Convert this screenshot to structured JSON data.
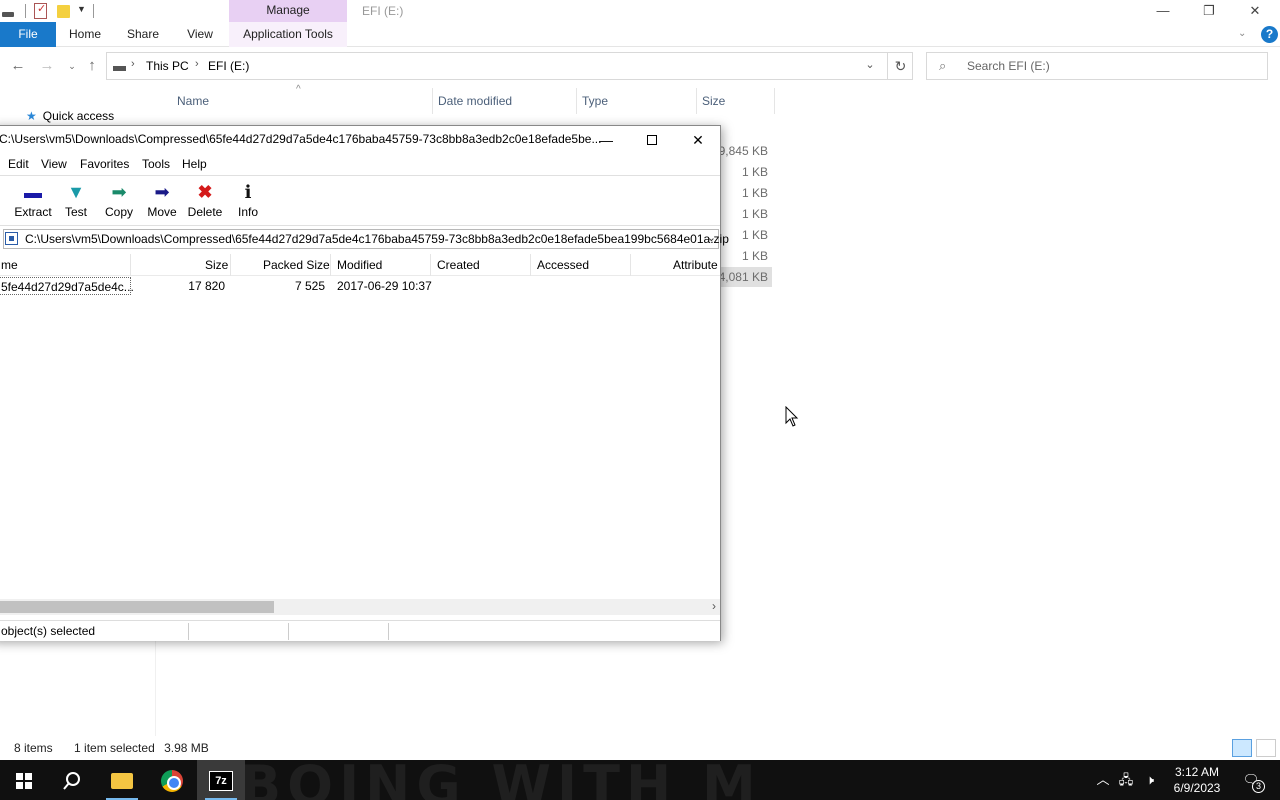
{
  "explorer": {
    "title": "EFI (E:)",
    "contextual_group": "Manage",
    "ribbon_tabs": {
      "file": "File",
      "home": "Home",
      "share": "Share",
      "view": "View",
      "app_tools": "Application Tools"
    },
    "breadcrumb": [
      "This PC",
      "EFI (E:)"
    ],
    "search_placeholder": "Search EFI (E:)",
    "columns": {
      "name": "Name",
      "date": "Date modified",
      "type": "Type",
      "size": "Size"
    },
    "nav_pane": {
      "quick_access": "Quick access"
    },
    "sizes": [
      "9,845 KB",
      "1 KB",
      "1 KB",
      "1 KB",
      "1 KB",
      "1 KB",
      "4,081 KB"
    ],
    "status": {
      "items": "8 items",
      "selected": "1 item selected",
      "selected_size": "3.98 MB"
    }
  },
  "zip": {
    "title": "C:\\Users\\vm5\\Downloads\\Compressed\\65fe44d27d29d7a5de4c176baba45759-73c8bb8a3edb2c0e18efade5be...",
    "menu": {
      "edit": "Edit",
      "view": "View",
      "favorites": "Favorites",
      "tools": "Tools",
      "help": "Help"
    },
    "toolbar": {
      "extract": "Extract",
      "test": "Test",
      "copy": "Copy",
      "move": "Move",
      "delete": "Delete",
      "info": "Info"
    },
    "path": "C:\\Users\\vm5\\Downloads\\Compressed\\65fe44d27d29d7a5de4c176baba45759-73c8bb8a3edb2c0e18efade5bea199bc5684e01a.zip",
    "columns": {
      "name": "me",
      "size": "Size",
      "packed": "Packed Size",
      "modified": "Modified",
      "created": "Created",
      "accessed": "Accessed",
      "attributes": "Attribute"
    },
    "rows": [
      {
        "name": "5fe44d27d29d7a5de4c...",
        "size": "17 820",
        "packed": "7 525",
        "modified": "2017-06-29 10:37",
        "created": "",
        "accessed": "",
        "attributes": ""
      }
    ],
    "status": "object(s) selected"
  },
  "taskbar": {
    "time": "3:12 AM",
    "date": "6/9/2023",
    "notifications": "3",
    "seven_zip_label": "7z"
  }
}
